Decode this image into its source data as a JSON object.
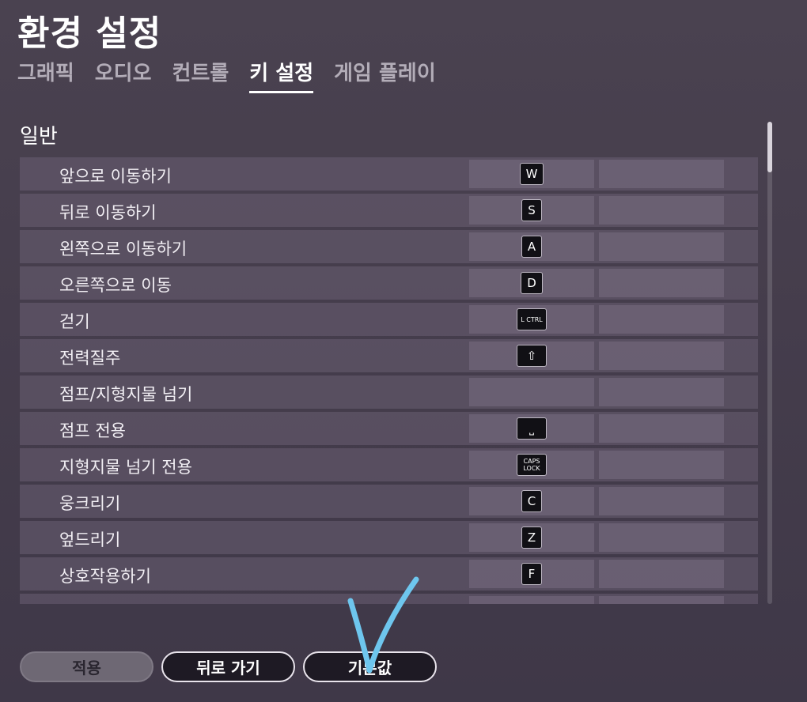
{
  "header": {
    "title": "환경 설정"
  },
  "tabs": [
    {
      "label": "그래픽",
      "active": false
    },
    {
      "label": "오디오",
      "active": false
    },
    {
      "label": "컨트롤",
      "active": false
    },
    {
      "label": "키 설정",
      "active": true
    },
    {
      "label": "게임 플레이",
      "active": false
    }
  ],
  "section": {
    "title": "일반"
  },
  "bindings": [
    {
      "action": "앞으로 이동하기",
      "primary": "W",
      "secondary": ""
    },
    {
      "action": "뒤로 이동하기",
      "primary": "S",
      "secondary": ""
    },
    {
      "action": "왼쪽으로 이동하기",
      "primary": "A",
      "secondary": ""
    },
    {
      "action": "오른쪽으로 이동",
      "primary": "D",
      "secondary": ""
    },
    {
      "action": "걷기",
      "primary": "L CTRL",
      "secondary": ""
    },
    {
      "action": "전력질주",
      "primary": "⇧",
      "secondary": ""
    },
    {
      "action": "점프/지형지물 넘기",
      "primary": "",
      "secondary": ""
    },
    {
      "action": "점프 전용",
      "primary": "⎵",
      "secondary": ""
    },
    {
      "action": "지형지물 넘기 전용",
      "primary": "CAPS\nLOCK",
      "secondary": ""
    },
    {
      "action": "웅크리기",
      "primary": "C",
      "secondary": ""
    },
    {
      "action": "엎드리기",
      "primary": "Z",
      "secondary": ""
    },
    {
      "action": "상호작용하기",
      "primary": "F",
      "secondary": ""
    },
    {
      "action": "",
      "primary": "",
      "secondary": ""
    }
  ],
  "footer": {
    "apply_label": "적용",
    "back_label": "뒤로 가기",
    "default_label": "기본값"
  },
  "colors": {
    "background": "#453d4c",
    "row": "#5d5468",
    "annotation_check": "#6ec6ee"
  }
}
